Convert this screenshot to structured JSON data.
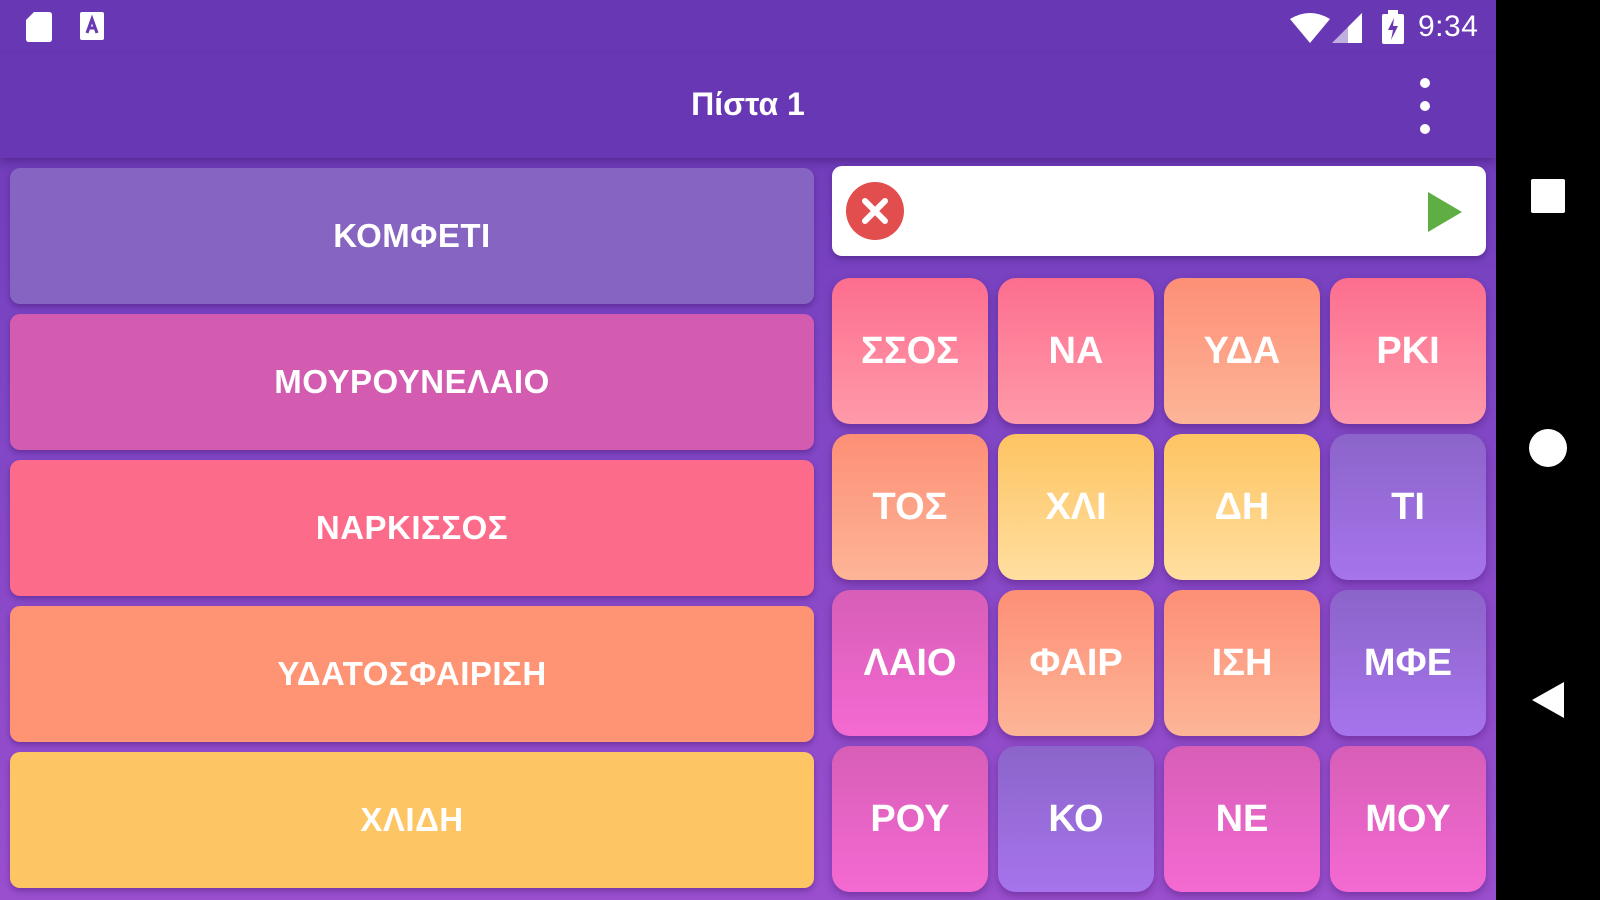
{
  "status_bar": {
    "time": "9:34",
    "icons": [
      "sd-card-icon",
      "a-notification-icon",
      "wifi-icon",
      "signal-icon",
      "battery-charging-icon"
    ]
  },
  "app_bar": {
    "title": "Πίστα 1",
    "menu_icon": "overflow-menu-icon"
  },
  "words": [
    {
      "label": "ΚΟΜΦΕΤΙ",
      "color": "#8564c2"
    },
    {
      "label": "ΜΟΥΡΟΥΝΕΛΑΙΟ",
      "color": "#d35bb0"
    },
    {
      "label": "ΝΑΡΚΙΣΣΟΣ",
      "color": "#fd6b8b"
    },
    {
      "label": "ΥΔΑΤΟΣΦΑΙΡΙΣΗ",
      "color": "#fe9473"
    },
    {
      "label": "ΧΛΙΔΗ",
      "color": "#fec564"
    }
  ],
  "answer": {
    "value": "",
    "clear_icon": "clear-x-icon",
    "submit_icon": "play-submit-icon"
  },
  "tiles": [
    {
      "label": "ΣΣΟΣ",
      "color": "red"
    },
    {
      "label": "ΝΑ",
      "color": "red"
    },
    {
      "label": "ΥΔΑ",
      "color": "orange"
    },
    {
      "label": "ΡΚΙ",
      "color": "red"
    },
    {
      "label": "ΤΟΣ",
      "color": "orange"
    },
    {
      "label": "ΧΛΙ",
      "color": "yellow"
    },
    {
      "label": "ΔΗ",
      "color": "yellow"
    },
    {
      "label": "ΤΙ",
      "color": "purple"
    },
    {
      "label": "ΛΑΙΟ",
      "color": "pink"
    },
    {
      "label": "ΦΑΙΡ",
      "color": "orange"
    },
    {
      "label": "ΙΣΗ",
      "color": "orange"
    },
    {
      "label": "ΜΦΕ",
      "color": "purple"
    },
    {
      "label": "ΡΟΥ",
      "color": "pink"
    },
    {
      "label": "ΚΟ",
      "color": "purple"
    },
    {
      "label": "ΝΕ",
      "color": "pink"
    },
    {
      "label": "ΜΟΥ",
      "color": "pink"
    }
  ],
  "nav_bar": {
    "buttons": [
      "recents-square-icon",
      "home-circle-icon",
      "back-triangle-icon"
    ]
  }
}
